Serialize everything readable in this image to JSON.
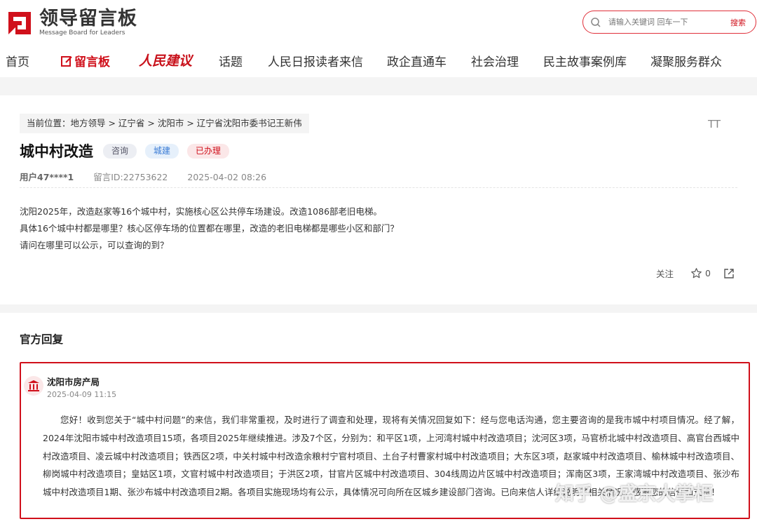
{
  "header": {
    "logo_title": "领导留言板",
    "logo_subtitle": "Message Board for Leaders",
    "search_placeholder": "请输入关键词 回车一下",
    "search_button": "搜索"
  },
  "nav": {
    "items": [
      {
        "label": "首页"
      },
      {
        "label": "留言板"
      },
      {
        "label": "人民建议"
      },
      {
        "label": "话题"
      },
      {
        "label": "人民日报读者来信"
      },
      {
        "label": "政企直通车"
      },
      {
        "label": "社会治理"
      },
      {
        "label": "民主故事案例库"
      },
      {
        "label": "凝聚服务群众"
      }
    ]
  },
  "message": {
    "breadcrumb": "当前位置：地方领导 > 辽宁省 > 沈阳市 > 辽宁省沈阳市委书记王新伟",
    "font_toggle": "TT",
    "title": "城中村改造",
    "tags": [
      "咨询",
      "城建",
      "已办理"
    ],
    "user": "用户47****1",
    "message_id": "留言ID:22753622",
    "time": "2025-04-02 08:26",
    "lines": [
      "沈阳2025年，改造赵家等16个城中村，实施核心区公共停车场建设。改造1086部老旧电梯。",
      "具体16个城中村都是哪里？核心区停车场的位置都在哪里，改造的老旧电梯都是哪些小区和部门？",
      "请问在哪里可以公示，可以查询的到？"
    ],
    "follow_label": "关注",
    "star_count": "0"
  },
  "reply": {
    "section_title": "官方回复",
    "org_name": "沈阳市房产局",
    "time": "2025-04-09 11:15",
    "text": "您好！收到您关于“城中村问题”的来信，我们非常重视，及时进行了调查和处理，现将有关情况回复如下：经与您电话沟通，您主要咨询的是我市城中村项目情况。经了解，2024年沈阳市城中村改造项目15项，各项目2025年继续推进。涉及7个区，分别为：和平区1项，上河湾村城中村改造项目；沈河区3项，马官桥北城中村改造项目、高官台西城中村改造项目、凌云城中村改造项目；铁西区2项，中关村城中村改造余粮村宁官村项目、土台子村曹家村城中村改造项目；大东区3项，赵家城中村改造项目、榆林城中村改造项目、柳岗城中村改造项目；皇姑区1项，文官村城中村改造项目；于洪区2项，甘官片区城中村改造项目、304线周边片区城中村改造项目；浑南区3项，王家湾城中村改造项目、张沙布城中村改造项目1期、张沙布城中村改造项目2期。各项目实施现场均有公示，具体情况可向所在区城乡建设部门咨询。已向来信人详细说明了相关情况。感谢您的信任和支持！"
  },
  "watermark": "知乎 @盛京大掌柜",
  "colors": {
    "accent": "#d0101b",
    "background": "#f4f4f4"
  }
}
